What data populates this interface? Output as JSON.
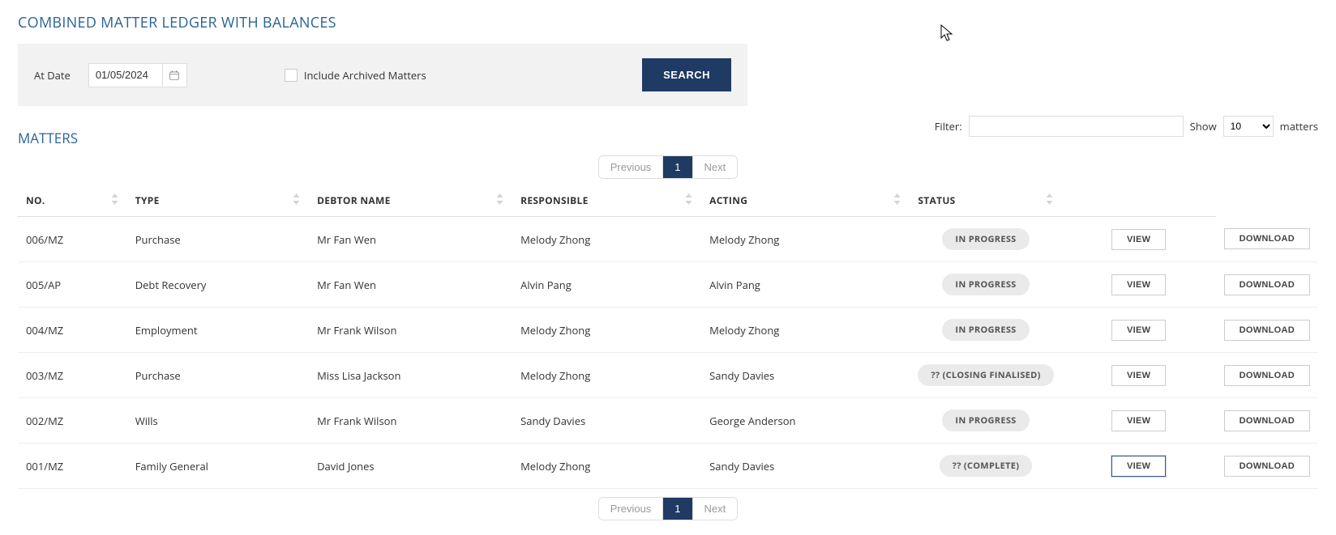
{
  "page_title": "COMBINED MATTER LEDGER WITH BALANCES",
  "search": {
    "date_label": "At Date",
    "date_value": "01/05/2024",
    "include_archived_label": "Include Archived Matters",
    "include_archived_checked": false,
    "search_button": "SEARCH"
  },
  "section_title": "MATTERS",
  "filter": {
    "label": "Filter:",
    "value": "",
    "show_label": "Show",
    "show_value": "10",
    "show_suffix": "matters"
  },
  "pager": {
    "previous": "Previous",
    "page": "1",
    "next": "Next"
  },
  "columns": {
    "no": "NO.",
    "type": "TYPE",
    "debtor": "DEBTOR NAME",
    "responsible": "RESPONSIBLE",
    "acting": "ACTING",
    "status": "STATUS"
  },
  "buttons": {
    "view": "VIEW",
    "download": "DOWNLOAD"
  },
  "rows": [
    {
      "no": "006/MZ",
      "type": "Purchase",
      "debtor": "Mr Fan Wen",
      "responsible": "Melody Zhong",
      "acting": "Melody Zhong",
      "status": "IN PROGRESS",
      "view_focused": false
    },
    {
      "no": "005/AP",
      "type": "Debt Recovery",
      "debtor": "Mr Fan Wen",
      "responsible": "Alvin Pang",
      "acting": "Alvin Pang",
      "status": "IN PROGRESS",
      "view_focused": false
    },
    {
      "no": "004/MZ",
      "type": "Employment",
      "debtor": "Mr Frank Wilson",
      "responsible": "Melody Zhong",
      "acting": "Melody Zhong",
      "status": "IN PROGRESS",
      "view_focused": false
    },
    {
      "no": "003/MZ",
      "type": "Purchase",
      "debtor": "Miss Lisa Jackson",
      "responsible": "Melody Zhong",
      "acting": "Sandy Davies",
      "status": "?? (CLOSING FINALISED)",
      "view_focused": false
    },
    {
      "no": "002/MZ",
      "type": "Wills",
      "debtor": "Mr Frank Wilson",
      "responsible": "Sandy Davies",
      "acting": "George Anderson",
      "status": "IN PROGRESS",
      "view_focused": false
    },
    {
      "no": "001/MZ",
      "type": "Family General",
      "debtor": "David Jones",
      "responsible": "Melody Zhong",
      "acting": "Sandy Davies",
      "status": "?? (COMPLETE)",
      "view_focused": true
    }
  ]
}
